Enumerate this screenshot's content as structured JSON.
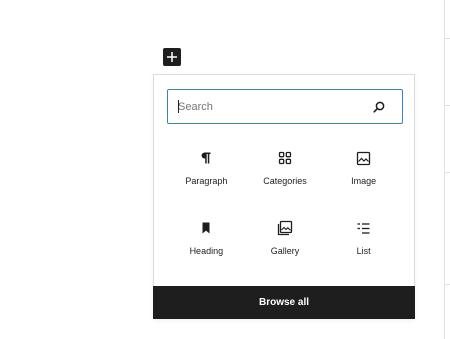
{
  "inserter": {
    "toggle_icon": "plus-icon",
    "search": {
      "placeholder": "Search",
      "value": "",
      "icon": "search-icon"
    },
    "blocks": [
      {
        "label": "Paragraph",
        "icon": "paragraph-icon"
      },
      {
        "label": "Categories",
        "icon": "categories-icon"
      },
      {
        "label": "Image",
        "icon": "image-icon"
      },
      {
        "label": "Heading",
        "icon": "heading-bookmark-icon"
      },
      {
        "label": "Gallery",
        "icon": "gallery-icon"
      },
      {
        "label": "List",
        "icon": "list-icon"
      }
    ],
    "browse_all_label": "Browse all"
  },
  "colors": {
    "accent": "#3582c4",
    "dark": "#1e1e1e",
    "border": "#dcdcde"
  }
}
